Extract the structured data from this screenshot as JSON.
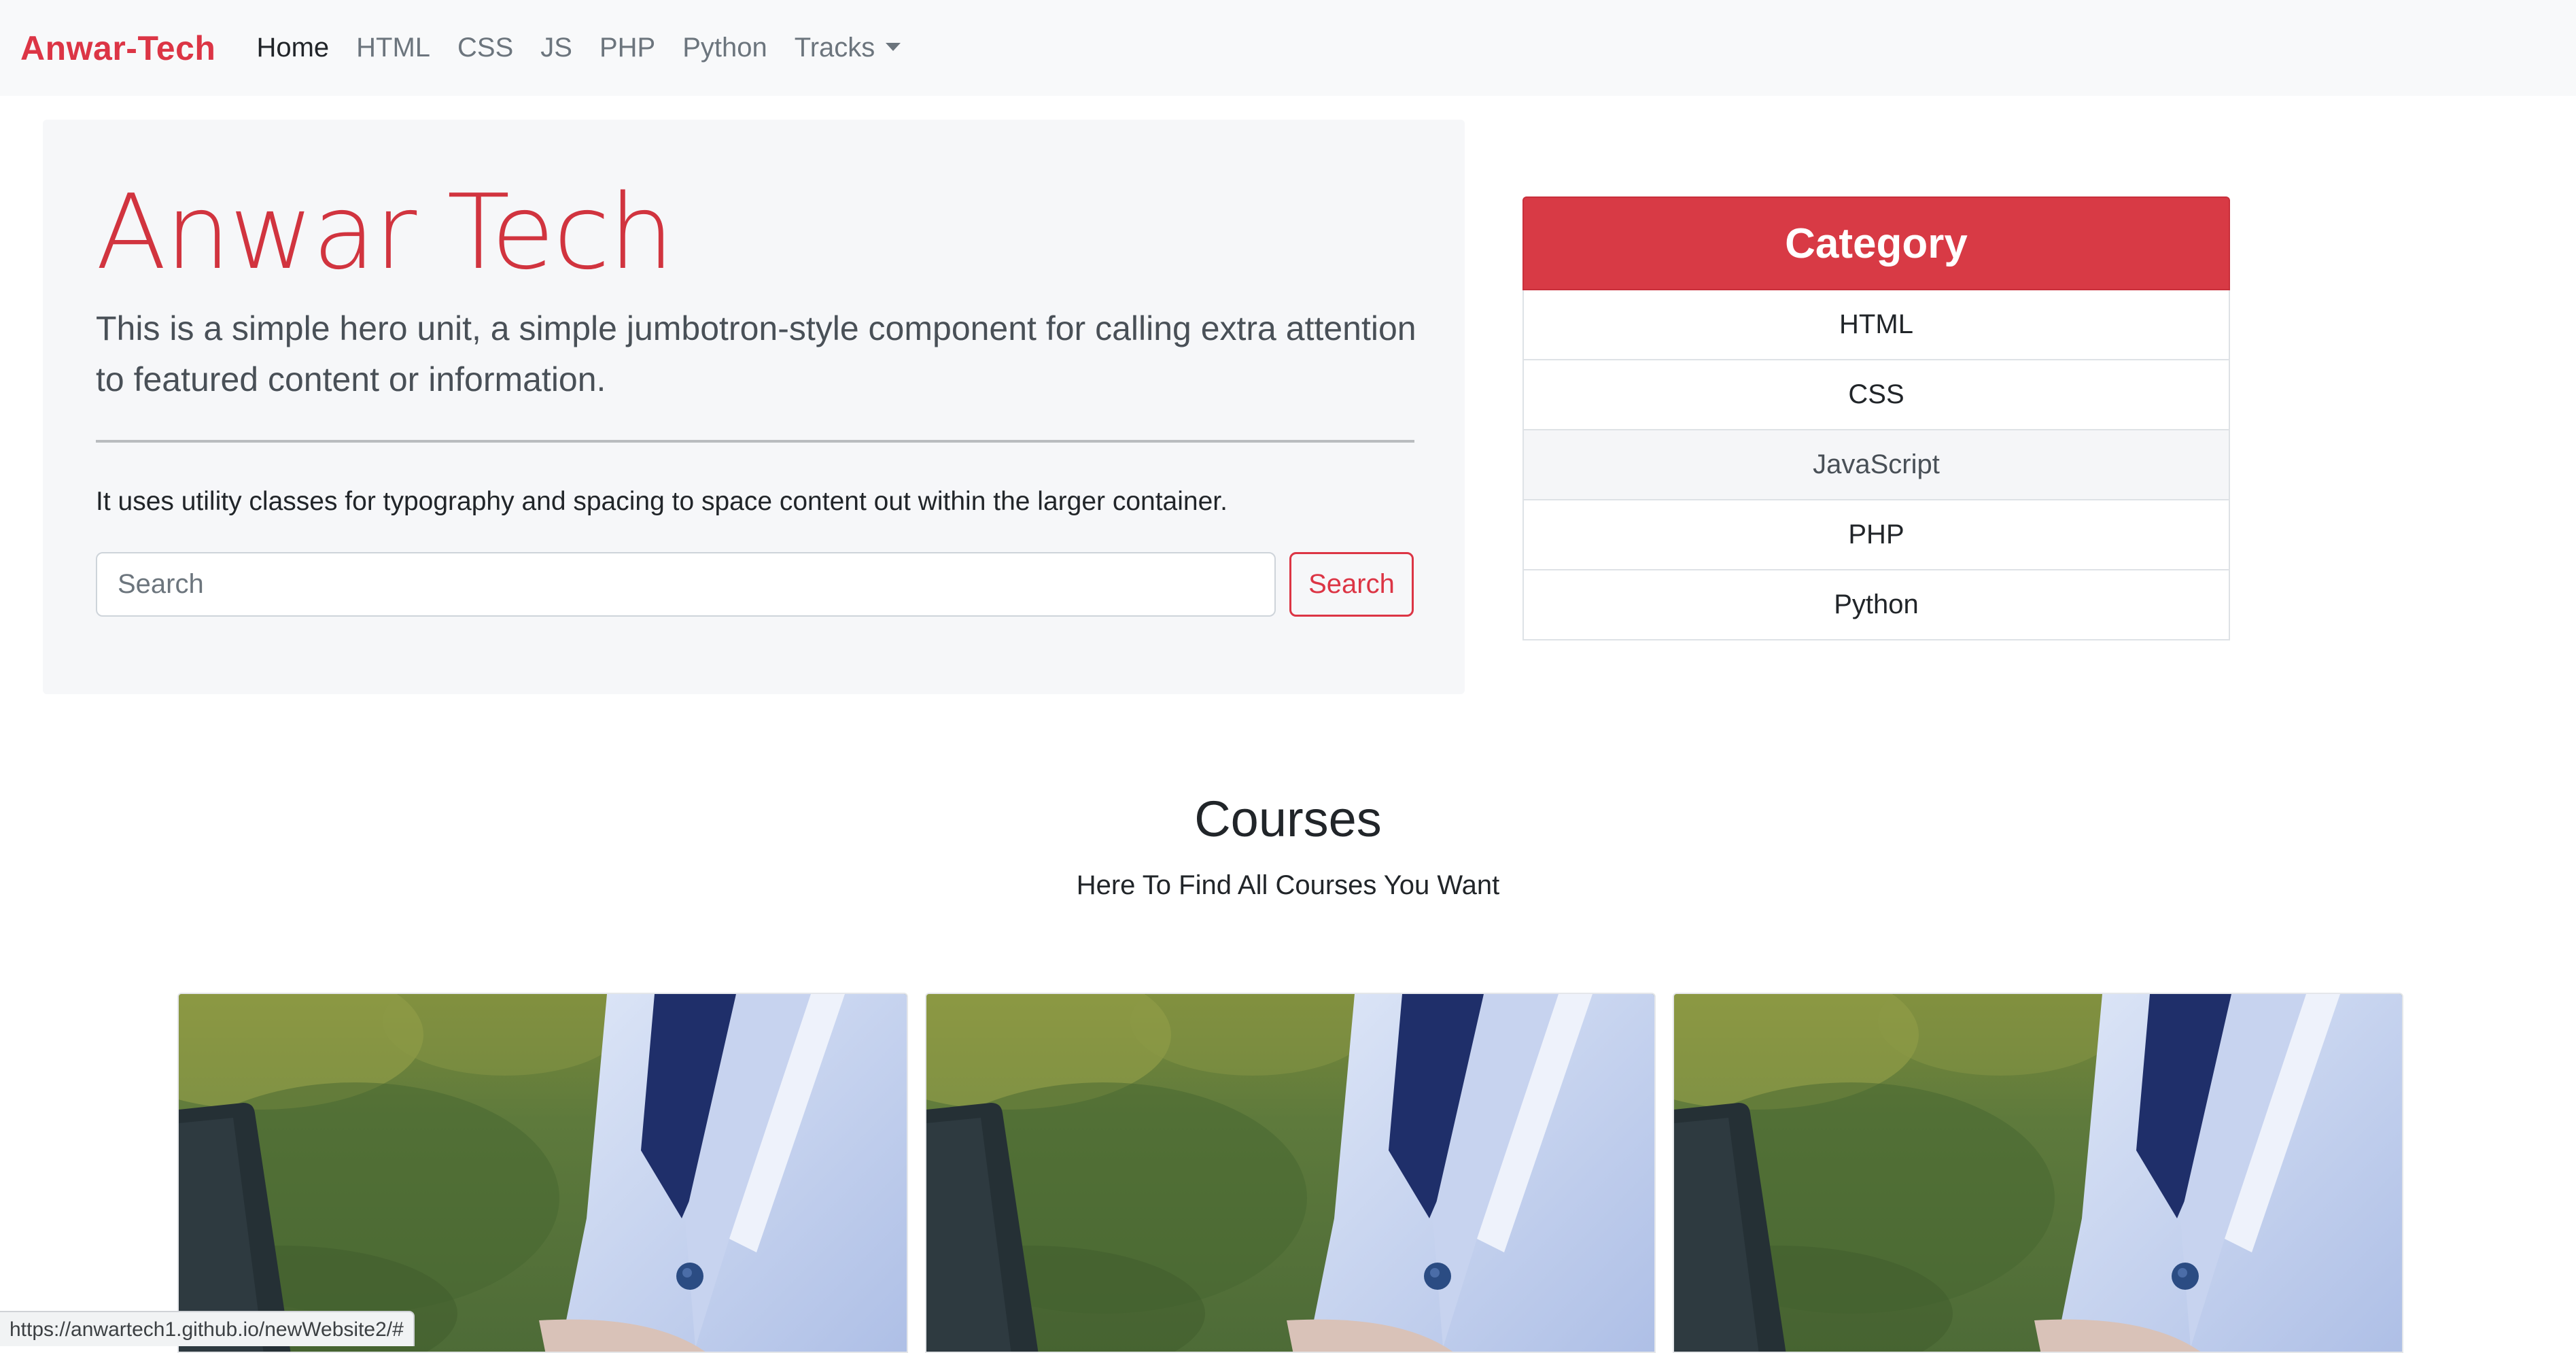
{
  "navbar": {
    "brand": "Anwar-Tech",
    "items": [
      {
        "label": "Home"
      },
      {
        "label": "HTML"
      },
      {
        "label": "CSS"
      },
      {
        "label": "JS"
      },
      {
        "label": "PHP"
      },
      {
        "label": "Python"
      },
      {
        "label": "Tracks"
      }
    ]
  },
  "hero": {
    "title": "Anwar Tech",
    "lead": "This is a simple hero unit, a simple jumbotron-style component for calling extra attention to featured content or information.",
    "body": "It uses utility classes for typography and spacing to space content out within the larger container.",
    "search_placeholder": "Search",
    "search_button": "Search"
  },
  "category": {
    "title": "Category",
    "items": [
      {
        "label": "HTML"
      },
      {
        "label": "CSS"
      },
      {
        "label": "JavaScript"
      },
      {
        "label": "PHP"
      },
      {
        "label": "Python"
      }
    ]
  },
  "courses": {
    "title": "Courses",
    "subtitle": "Here To Find All Courses You Want"
  },
  "status_url": "https://anwartech1.github.io/newWebsite2/#"
}
